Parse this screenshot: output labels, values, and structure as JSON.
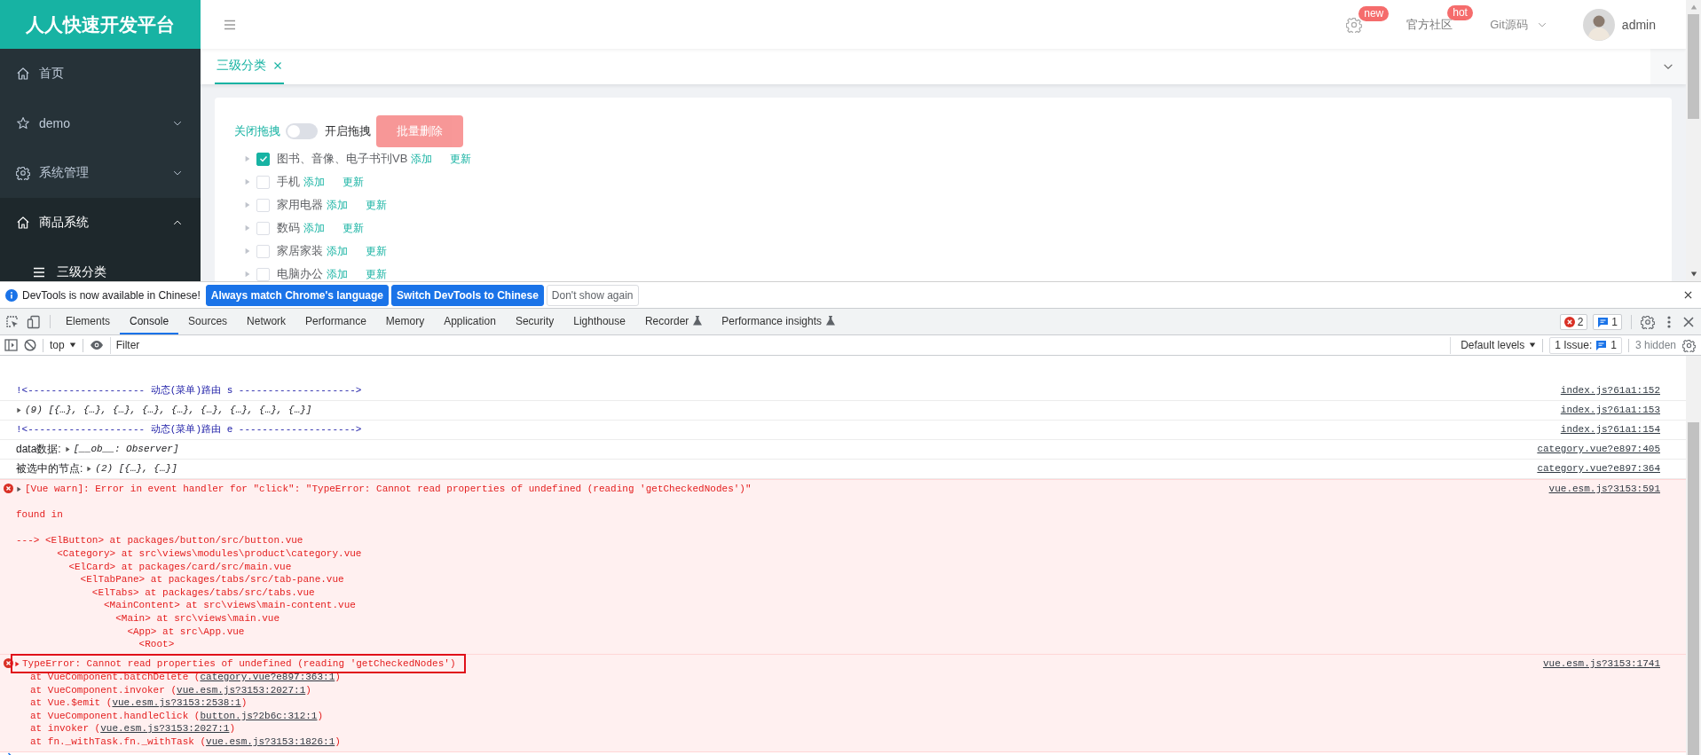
{
  "app": {
    "logo": "人人快速开发平台",
    "header": {
      "settings_badge": "new",
      "links": [
        {
          "label": "官方社区",
          "kind": "badge",
          "badge": "hot"
        },
        {
          "label": "Git源码",
          "kind": "dropdown"
        }
      ],
      "user": "admin"
    },
    "sidebar": [
      {
        "label": "首页",
        "kind": "link",
        "expanded": false
      },
      {
        "label": "demo",
        "kind": "submenu",
        "expanded": false
      },
      {
        "label": "系统管理",
        "kind": "submenu",
        "expanded": false
      },
      {
        "label": "商品系统",
        "kind": "submenu",
        "expanded": true,
        "children": [
          {
            "label": "三级分类",
            "selected": true
          }
        ]
      }
    ],
    "tabs": [
      {
        "label": "三级分类",
        "selected": true
      }
    ],
    "toolbar": {
      "off_label": "关闭拖拽",
      "drag_switch": {
        "on": false
      },
      "on_label": "开启拖拽",
      "batch_delete": {
        "label": "批量删除",
        "disabled": true
      }
    },
    "tree": [
      {
        "label": "图书、音像、电子书刊VB",
        "checked": true,
        "actions": [
          "添加",
          "更新"
        ]
      },
      {
        "label": "手机",
        "checked": false,
        "actions": [
          "添加",
          "更新"
        ]
      },
      {
        "label": "家用电器",
        "checked": false,
        "actions": [
          "添加",
          "更新"
        ]
      },
      {
        "label": "数码",
        "checked": false,
        "actions": [
          "添加",
          "更新"
        ]
      },
      {
        "label": "家居家装",
        "checked": false,
        "actions": [
          "添加",
          "更新"
        ]
      },
      {
        "label": "电脑办公",
        "checked": false,
        "actions": [
          "添加",
          "更新"
        ]
      }
    ]
  },
  "devtools": {
    "infobar": {
      "message": "DevTools is now available in Chinese!",
      "buttons": [
        {
          "label": "Always match Chrome's language",
          "kind": "primary"
        },
        {
          "label": "Switch DevTools to Chinese",
          "kind": "primary"
        },
        {
          "label": "Don't show again",
          "kind": "secondary"
        }
      ]
    },
    "tabs": [
      {
        "label": "Elements",
        "kind": "plain",
        "selected": false
      },
      {
        "label": "Console",
        "kind": "plain",
        "selected": true
      },
      {
        "label": "Sources",
        "kind": "plain",
        "selected": false
      },
      {
        "label": "Network",
        "kind": "plain",
        "selected": false
      },
      {
        "label": "Performance",
        "kind": "plain",
        "selected": false
      },
      {
        "label": "Memory",
        "kind": "plain",
        "selected": false
      },
      {
        "label": "Application",
        "kind": "plain",
        "selected": false
      },
      {
        "label": "Security",
        "kind": "plain",
        "selected": false
      },
      {
        "label": "Lighthouse",
        "kind": "plain",
        "selected": false
      },
      {
        "label": "Recorder",
        "kind": "experimental",
        "selected": false
      },
      {
        "label": "Performance insights",
        "kind": "experimental",
        "selected": false
      }
    ],
    "counters": {
      "errors": "2",
      "messages": "1"
    },
    "console_toolbar": {
      "context": "top",
      "filter_placeholder": "Filter",
      "levels": "Default levels",
      "issues_label": "1 Issue:",
      "issues_count": "1",
      "hidden": "3 hidden"
    },
    "messages": [
      {
        "kind": "route",
        "text": "!<-------------------- 动态(菜单)路由 s -------------------->",
        "source": "index.js?61a1:152"
      },
      {
        "kind": "object",
        "preview": "(9) [{…}, {…}, {…}, {…}, {…}, {…}, {…}, {…}, {…}]",
        "source": "index.js?61a1:153"
      },
      {
        "kind": "route",
        "text": "!<-------------------- 动态(菜单)路由 e -------------------->",
        "source": "index.js?61a1:154"
      },
      {
        "kind": "object",
        "label": "data数据:",
        "preview": "[__ob__: Observer]",
        "source": "category.vue?e897:405"
      },
      {
        "kind": "object",
        "label": "被选中的节点:",
        "preview": "(2) [{…}, {…}]",
        "source": "category.vue?e897:364"
      },
      {
        "kind": "warning_error",
        "highlighted": false,
        "message": "[Vue warn]: Error in event handler for \"click\": \"TypeError: Cannot read properties of undefined (reading 'getCheckedNodes')\"",
        "details": "found in",
        "trace": [
          "---> <ElButton> at packages/button/src/button.vue",
          "       <Category> at src\\views\\modules\\product\\category.vue",
          "         <ElCard> at packages/card/src/main.vue",
          "           <ElTabPane> at packages/tabs/src/tab-pane.vue",
          "             <ElTabs> at packages/tabs/src/tabs.vue",
          "               <MainContent> at src\\views\\main-content.vue",
          "                 <Main> at src\\views\\main.vue",
          "                   <App> at src\\App.vue",
          "                     <Root>"
        ],
        "source": "vue.esm.js?3153:591"
      },
      {
        "kind": "stack_error",
        "highlighted": true,
        "message": "TypeError: Cannot read properties of undefined (reading 'getCheckedNodes')",
        "stack": [
          {
            "prefix": "at VueComponent.batchDelete (",
            "link": "category.vue?e897:363:1",
            "suffix": ")"
          },
          {
            "prefix": "at VueComponent.invoker (",
            "link": "vue.esm.js?3153:2027:1",
            "suffix": ")"
          },
          {
            "prefix": "at Vue.$emit (",
            "link": "vue.esm.js?3153:2538:1",
            "suffix": ")"
          },
          {
            "prefix": "at VueComponent.handleClick (",
            "link": "button.js?2b6c:312:1",
            "suffix": ")"
          },
          {
            "prefix": "at invoker (",
            "link": "vue.esm.js?3153:2027:1",
            "suffix": ")"
          },
          {
            "prefix": "at fn._withTask.fn._withTask (",
            "link": "vue.esm.js?3153:1826:1",
            "suffix": ")"
          }
        ],
        "source": "vue.esm.js?3153:1741"
      }
    ]
  }
}
